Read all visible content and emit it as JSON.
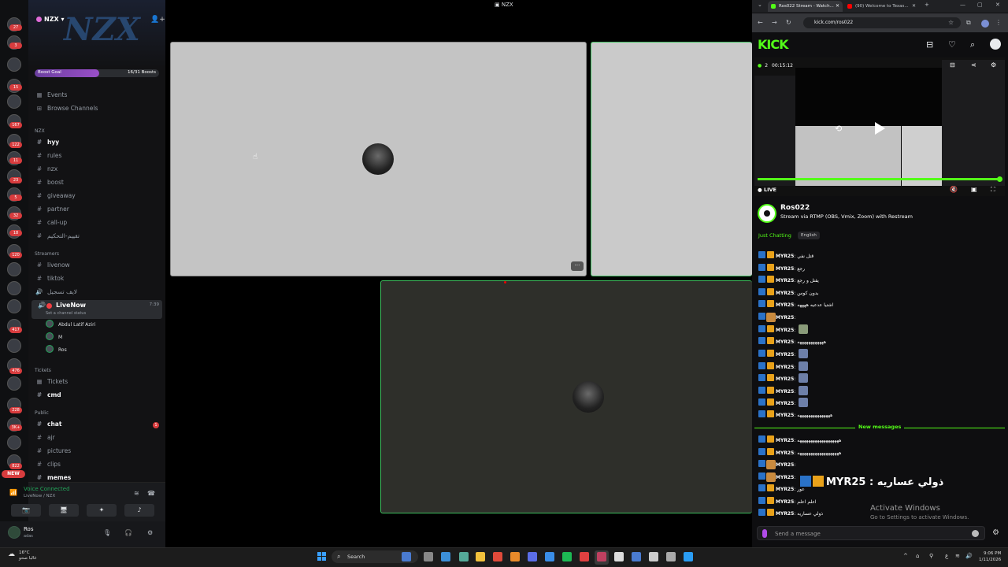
{
  "discord": {
    "rail_badges": [
      "27",
      "3",
      "15",
      "167",
      "122",
      "11",
      "23",
      "5",
      "32",
      "18",
      "120",
      "417",
      "476",
      "228",
      "3K+",
      "822",
      "NEW"
    ],
    "server_name": "NZX",
    "banner_logo": "NZX",
    "boost": {
      "label": "Boost Goal",
      "count": "16/31 Boosts",
      "progress": 0.52
    },
    "top_links": [
      {
        "label": "Events",
        "icon": "calendar-icon"
      },
      {
        "label": "Browse Channels",
        "icon": "browse-icon"
      }
    ],
    "categories": {
      "nzx": "NZX",
      "streamers": "Streamers",
      "tickets": "Tickets",
      "public": "Public"
    },
    "nzx_channels": [
      "hyy",
      "rules",
      "nzx",
      "boost",
      "giveaway",
      "partner",
      "call-up",
      "تقييم-التحكيم"
    ],
    "streamer_channels": [
      "livenow",
      "tiktok",
      "لايف تسجيل"
    ],
    "live_voice": {
      "name": "LiveNow",
      "status": "Set a channel status",
      "time": "7:39",
      "users": [
        "Abdul Latif Aziri",
        "M",
        "Ros"
      ]
    },
    "ticket_channels": [
      "Tickets",
      "cmd"
    ],
    "public_channels": [
      "chat",
      "ajr",
      "pictures",
      "clips",
      "memes"
    ],
    "chat_unread": "1",
    "voice_status": {
      "title": "Voice Connected",
      "path": "LiveNow / NZX"
    },
    "user": {
      "name": "Ros",
      "status": "adas"
    }
  },
  "stage": {
    "window_title": "NZX",
    "tiles": [
      {
        "name": "tile-1",
        "bg": "#c4c4c4"
      },
      {
        "name": "tile-2",
        "bg": "#cacaca"
      },
      {
        "name": "tile-3",
        "bg": "#2e2f2a"
      }
    ],
    "more_button": "···"
  },
  "browser": {
    "tabs": [
      {
        "title": "Ros022 Stream - Watch...",
        "active": true,
        "color": "#53fc18"
      },
      {
        "title": "(90) Welcome to Texas...",
        "active": false,
        "color": "#ff0000"
      }
    ],
    "url": "kick.com/ros022",
    "kick": {
      "logo": "KICK",
      "viewers": "2",
      "uptime": "00:15:12",
      "live_label": "LIVE",
      "progress": 0.99,
      "channel_name": "Ros022",
      "stream_title": "Stream via RTMP (OBS, Vmix, Zoom) with Restream",
      "category": "Just Chatting",
      "language": "English",
      "new_messages_label": "New messages",
      "input_placeholder": "Send a message",
      "messages_before": [
        {
          "user": "MYR25",
          "text": "قتل نفي"
        },
        {
          "user": "MYR25",
          "text": "رجع"
        },
        {
          "user": "MYR25",
          "text": "يقتل و رجع"
        },
        {
          "user": "MYR25",
          "text": "بدون كوس"
        },
        {
          "user": "MYR25",
          "text": "اشتيا عدعيه ههههه"
        },
        {
          "user": "MYR25",
          "text": "",
          "emote": "cat"
        },
        {
          "user": "MYR25",
          "text": "",
          "emote": "grn"
        },
        {
          "user": "MYR25",
          "text": "ههههههههههههه"
        },
        {
          "user": "MYR25",
          "text": "",
          "emote": "blue"
        },
        {
          "user": "MYR25",
          "text": "",
          "emote": "blue"
        },
        {
          "user": "MYR25",
          "text": "",
          "emote": "blue"
        },
        {
          "user": "MYR25",
          "text": "",
          "emote": "blue"
        },
        {
          "user": "MYR25",
          "text": "",
          "emote": "blue"
        },
        {
          "user": "MYR25",
          "text": "هههههههههههههههه"
        }
      ],
      "messages_after": [
        {
          "user": "MYR25",
          "text": "هههههههههههههههههههه"
        },
        {
          "user": "MYR25",
          "text": "هههههههههههههههههههه"
        },
        {
          "user": "MYR25",
          "text": "",
          "emote": "cat"
        },
        {
          "user": "MYR25",
          "text": "",
          "emote": "cat"
        },
        {
          "user": "MYR25",
          "text": "عور"
        },
        {
          "user": "MYR25",
          "text": "اعلم اعلم"
        },
        {
          "user": "MYR25",
          "text": "ذولي عساريه"
        }
      ],
      "overlay": {
        "user": "MYR25",
        "text": "ذولي عساريه"
      }
    },
    "activate_windows": {
      "title": "Activate Windows",
      "subtitle": "Go to Settings to activate Windows."
    }
  },
  "taskbar": {
    "weather": {
      "temp": "16°C",
      "desc": "غالبا صحو"
    },
    "search_label": "Search",
    "lang": "ع",
    "time": "9:06 PM",
    "date": "1/11/2026"
  }
}
